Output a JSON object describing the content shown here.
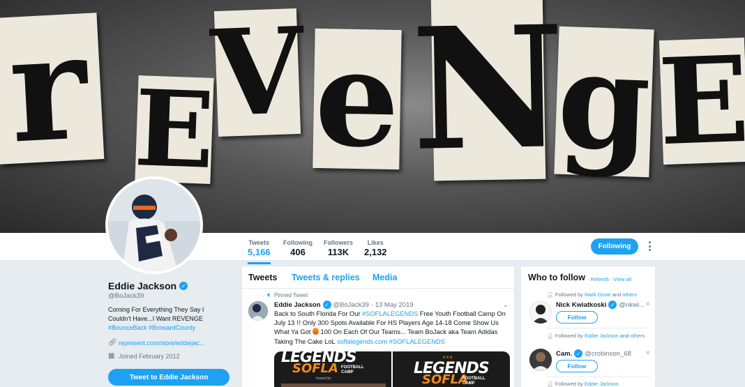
{
  "banner": {
    "letters": [
      "r",
      "E",
      "V",
      "e",
      "N",
      "g",
      "E"
    ]
  },
  "stats": [
    {
      "label": "Tweets",
      "value": "5,166"
    },
    {
      "label": "Following",
      "value": "406"
    },
    {
      "label": "Followers",
      "value": "113K"
    },
    {
      "label": "Likes",
      "value": "2,132"
    }
  ],
  "following_button": "Following",
  "profile": {
    "name": "Eddie Jackson",
    "handle": "@BoJack39",
    "bio": "Coming For Everything They Say I Couldn't Have...I Want REVENGE",
    "hashtags": "#BounceBack #BrowardCounty",
    "link": "represent.com/store/eddiejac...",
    "joined": "Joined February 2012",
    "tweet_to": "Tweet to Eddie Jackson"
  },
  "timeline": {
    "tabs": [
      "Tweets",
      "Tweets & replies",
      "Media"
    ],
    "pinned_label": "Pinned Tweet",
    "tweet": {
      "name": "Eddie Jackson",
      "handle": "@BoJack39",
      "date": "· 13 May 2019",
      "text_1": "Back to South Florida For Our ",
      "tag_1": "#SOFLALEGENDS",
      "text_2": " Free Youth Football Camp On July 13 ",
      "bang": "!!",
      "text_3": " Only 300 Spots Available For HS Players Age 14-18 Come Show Us What Ya Got ",
      "text_4": " 100 On Each Of Our Teams... Team BoJack aka Team Adidas Taking The Cake LoL ",
      "link": "soflalegends.com",
      "tag_2": "#SOFLALEGENDS"
    },
    "media": {
      "left": {
        "legends": "LEGENDS",
        "sofla": "SOFLA",
        "camp": "FOOTBALL CAMP",
        "hosted": "hosted by"
      },
      "right": {
        "stars": "x x x",
        "legends": "LEGENDS",
        "sofla": "SOFLA",
        "camp": "FOOTBALL CAMP"
      }
    }
  },
  "who_to_follow": {
    "title": "Who to follow",
    "refresh": "Refresh",
    "sep": "·",
    "view_all": "View all",
    "follow_label": "Follow",
    "suggestions": [
      {
        "context_prefix": "Followed by ",
        "context_link": "Mark Grote",
        "context_suffix": " and ",
        "context_link_2": "others",
        "name": "Nick Kwiatkoski",
        "handle": "@nkwi..."
      },
      {
        "context_prefix": "Followed by ",
        "context_link": "Eddie Jackson",
        "context_suffix": " and ",
        "context_link_2": "others",
        "name": "Cam.",
        "handle": "@crobinson_68"
      },
      {
        "context_prefix": "Followed by ",
        "context_link": "Eddie Jackson",
        "context_suffix": "",
        "context_link_2": ""
      }
    ]
  },
  "colors": {
    "accent": "#1da1f2",
    "background": "#e6ecf0",
    "text": "#14171a",
    "muted": "#657786"
  }
}
